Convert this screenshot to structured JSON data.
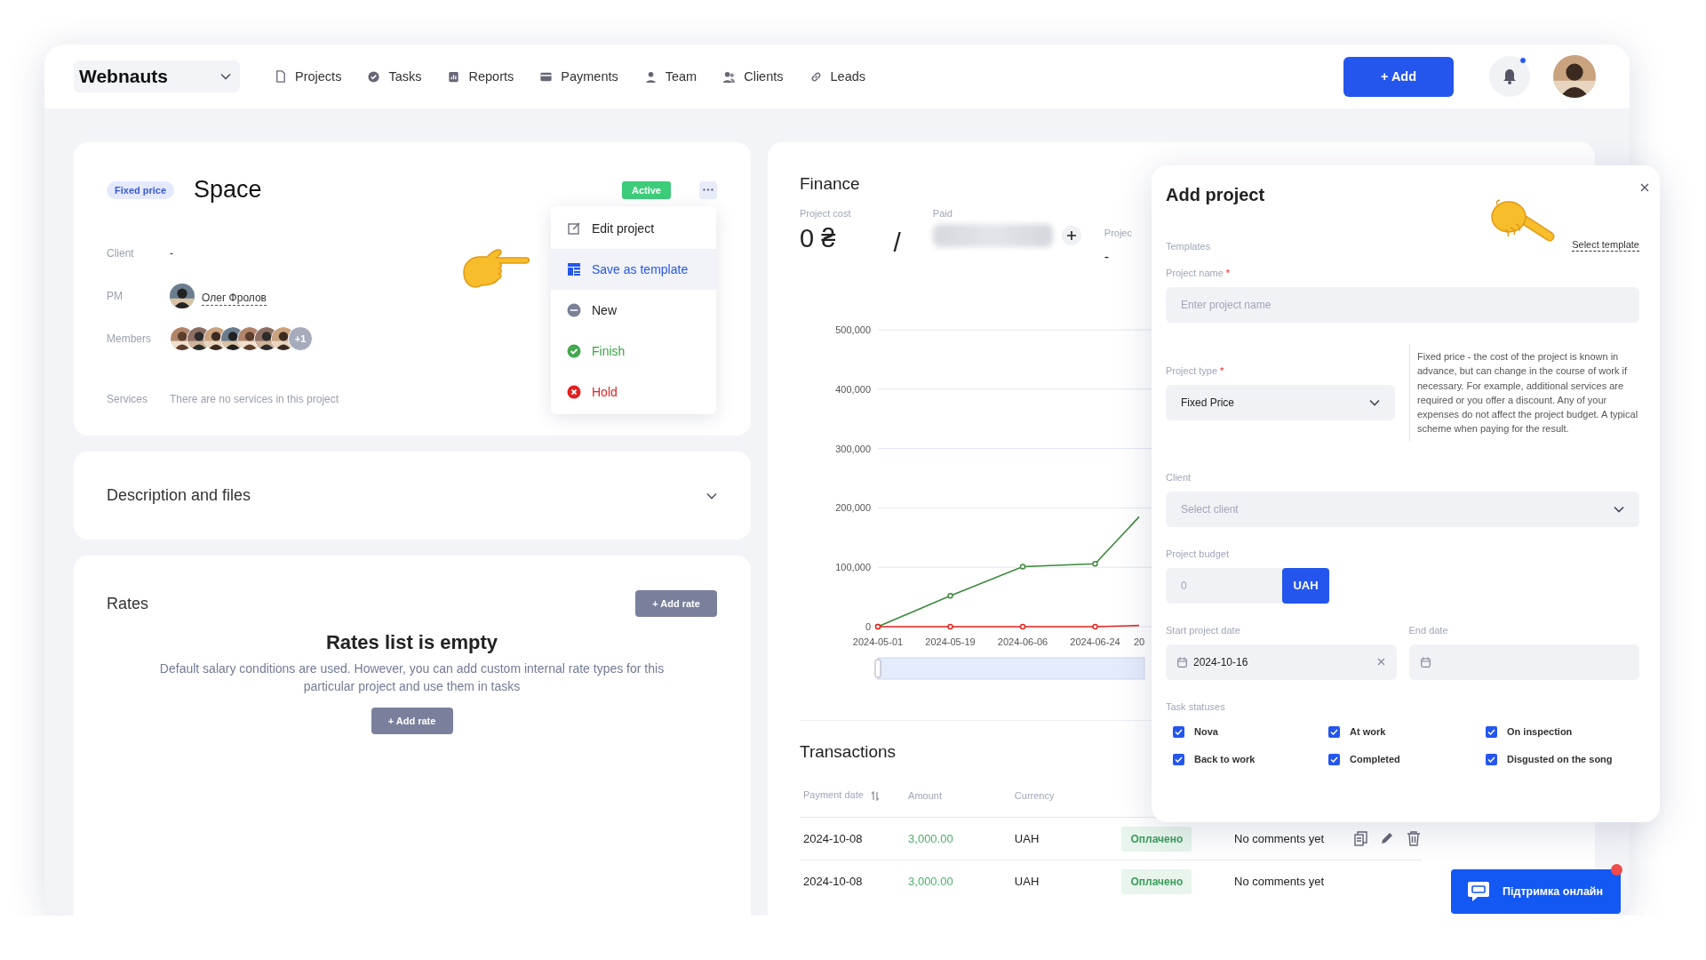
{
  "nav": {
    "brand": "Webnauts",
    "items": [
      {
        "label": "Projects",
        "kind": "file"
      },
      {
        "label": "Tasks",
        "kind": "check"
      },
      {
        "label": "Reports",
        "kind": "report"
      },
      {
        "label": "Payments",
        "kind": "card"
      },
      {
        "label": "Team",
        "kind": "user"
      },
      {
        "label": "Clients",
        "kind": "users"
      },
      {
        "label": "Leads",
        "kind": "link"
      }
    ],
    "add_button": "+ Add",
    "notifications": {
      "unread": true
    }
  },
  "project": {
    "type_tag": "Fixed price",
    "title": "Space",
    "status": "Active",
    "fields": [
      {
        "label": "Client",
        "kind": "text",
        "value": "-"
      },
      {
        "label": "PM",
        "kind": "person",
        "value": "Олег Фролов"
      },
      {
        "label": "Members",
        "kind": "avatars",
        "extra": "+1"
      },
      {
        "label": "Services",
        "kind": "muted",
        "value": "There are no services in this project"
      }
    ],
    "menu": [
      {
        "label": "Edit project",
        "kind": "edit",
        "selected": false
      },
      {
        "label": "Save as template",
        "kind": "template",
        "selected": true
      },
      {
        "label": "New",
        "kind": "new",
        "selected": false
      },
      {
        "label": "Finish",
        "kind": "finish",
        "selected": false
      },
      {
        "label": "Hold",
        "kind": "hold",
        "selected": false
      }
    ]
  },
  "description": {
    "title": "Description and files",
    "expanded": false
  },
  "rates": {
    "title": "Rates",
    "add_button": "+ Add rate",
    "empty_title": "Rates list is empty",
    "empty_text": "Default salary conditions are used. However, you can add custom internal rate types for this particular project and use them in tasks",
    "empty_button": "+ Add rate"
  },
  "finance": {
    "title": "Finance",
    "stats": [
      {
        "label": "Project cost",
        "kind": "value",
        "value": "0 ₴"
      },
      {
        "label": "Paid",
        "kind": "blurred"
      },
      {
        "label": "Projec",
        "kind": "value",
        "value": "-"
      }
    ],
    "separator": "/",
    "chart_data": {
      "type": "line",
      "categories": [
        "2024-05-01",
        "2024-05-19",
        "2024-06-06",
        "2024-06-24",
        "20"
      ],
      "grid": true,
      "series": [
        {
          "color": "#3a8a3a",
          "marker": true,
          "values": [
            0,
            52000,
            101000,
            106000,
            185000
          ]
        },
        {
          "color": "#e8231c",
          "marker": true,
          "values": [
            0,
            0,
            0,
            0,
            2000
          ]
        }
      ],
      "ylim": [
        0,
        500000
      ],
      "yticks": [
        {
          "value": 0,
          "label": "0"
        },
        {
          "value": 100000,
          "label": "100,000"
        },
        {
          "value": 200000,
          "label": "200,000"
        },
        {
          "value": 300000,
          "label": "300,000"
        },
        {
          "value": 400000,
          "label": "400,000"
        },
        {
          "value": 500000,
          "label": "500,000"
        }
      ]
    }
  },
  "transactions": {
    "title": "Transactions",
    "columns": [
      {
        "label": "Payment date",
        "sortable": true
      },
      {
        "label": "Amount",
        "sortable": false
      },
      {
        "label": "Currency",
        "sortable": false
      }
    ],
    "rows": [
      {
        "date": "2024-10-08",
        "amount": "3,000.00",
        "currency": "UAH",
        "status": "Оплачено",
        "comment": "No comments yet",
        "actions": true
      },
      {
        "date": "2024-10-08",
        "amount": "3,000.00",
        "currency": "UAH",
        "status": "Оплачено",
        "comment": "No comments yet",
        "actions": false
      }
    ]
  },
  "modal": {
    "title": "Add project",
    "templates_label": "Templates",
    "select_template": "Select template",
    "name_label": "Project name",
    "name_required": "*",
    "name_placeholder": "Enter project name",
    "type_label": "Project type",
    "type_required": "*",
    "type_value": "Fixed Price",
    "type_description": "Fixed price - the cost of the project is known in advance, but can change in the course of work if necessary. For example, additional services are required or you offer a discount. Any of your expenses do not affect the project budget. A typical scheme when paying for the result.",
    "client_label": "Client",
    "client_placeholder": "Select client",
    "budget_label": "Project budget",
    "budget_placeholder": "0",
    "currency": "UAH",
    "start_label": "Start project date",
    "start_value": "2024-10-16",
    "end_label": "End date",
    "statuses_label": "Task statuses",
    "statuses": [
      {
        "label": "Nova",
        "checked": true
      },
      {
        "label": "At work",
        "checked": true
      },
      {
        "label": "On inspection",
        "checked": true
      },
      {
        "label": "Back to work",
        "checked": true
      },
      {
        "label": "Completed",
        "checked": true
      },
      {
        "label": "Disgusted on the song",
        "checked": true
      }
    ]
  },
  "support": {
    "label": "Підтримка онлайн",
    "unread": true
  }
}
